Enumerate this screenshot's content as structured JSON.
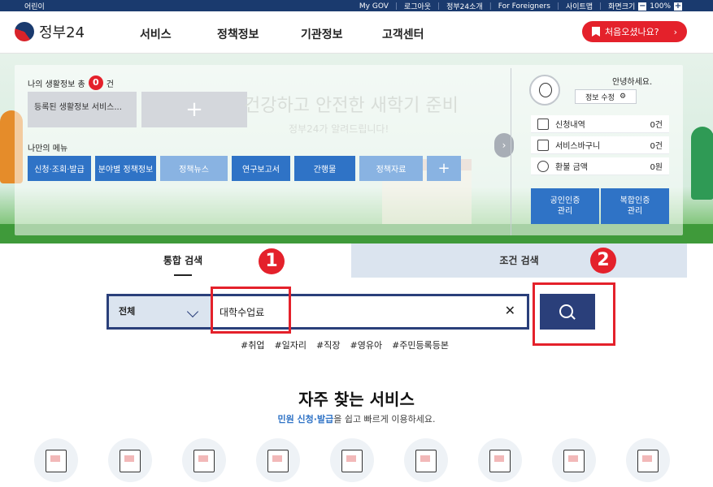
{
  "topbar": {
    "left": "어린이",
    "links": [
      "My GOV",
      "로그아웃",
      "정부24소개",
      "For Foreigners",
      "사이트맵"
    ],
    "zoom_label": "화면크기",
    "zoom_minus": "−",
    "zoom_value": "100%",
    "zoom_plus": "+"
  },
  "header": {
    "logo": "정부24",
    "nav": [
      "서비스",
      "정책정보",
      "기관정보",
      "고객센터"
    ],
    "first_visit": "처음오셨나요?",
    "first_visit_chev": "›"
  },
  "hero": {
    "life_info_prefix": "나의 생활정보  총",
    "life_info_count": "0",
    "life_info_suffix": "건",
    "life_card": "등록된 생활정보 서비스...",
    "add_symbol": "+",
    "title": "건강하고 안전한 새학기 준비",
    "subtitle": "정부24가 알려드립니다!",
    "my_menu": "나만의 메뉴",
    "menu_buttons": [
      "신청·조회·발급",
      "분야별 정책정보",
      "정책뉴스",
      "연구보고서",
      "간행물",
      "정책자료",
      "+"
    ],
    "next_arrow": "›"
  },
  "user": {
    "hello": "안녕하세요.",
    "edit": "정보 수정",
    "edit_icon": "⚙",
    "stats": [
      {
        "label": "신청내역",
        "value": "0건"
      },
      {
        "label": "서비스바구니",
        "value": "0건"
      },
      {
        "label": "환불 금액",
        "value": "0원"
      }
    ],
    "cert_public": "공인인증\n관리",
    "cert_complex": "복합인증\n관리"
  },
  "search": {
    "tab_integrated": "통합 검색",
    "tab_condition": "조건 검색",
    "scope": "전체",
    "query": "대학수업료",
    "clear": "✕",
    "hashtags": [
      "#취업",
      "#일자리",
      "#직장",
      "#영유아",
      "#주민등록등본"
    ],
    "annotation_1": "1",
    "annotation_2": "2"
  },
  "frequent": {
    "title": "자주 찾는 서비스",
    "sub_highlight": "민원 신청·발급",
    "sub_rest": "을 쉽고 빠르게 이용하세요.",
    "icons": [
      "id-card-icon",
      "online-apply-icon",
      "document-search-icon",
      "list-document-icon",
      "map-icon",
      "location-map-icon",
      "car-document-icon",
      "house-icon",
      "statistics-icon"
    ]
  },
  "colors": {
    "brand_navy": "#1a3a6e",
    "accent_red": "#e4212b",
    "button_blue": "#2f73c6"
  }
}
